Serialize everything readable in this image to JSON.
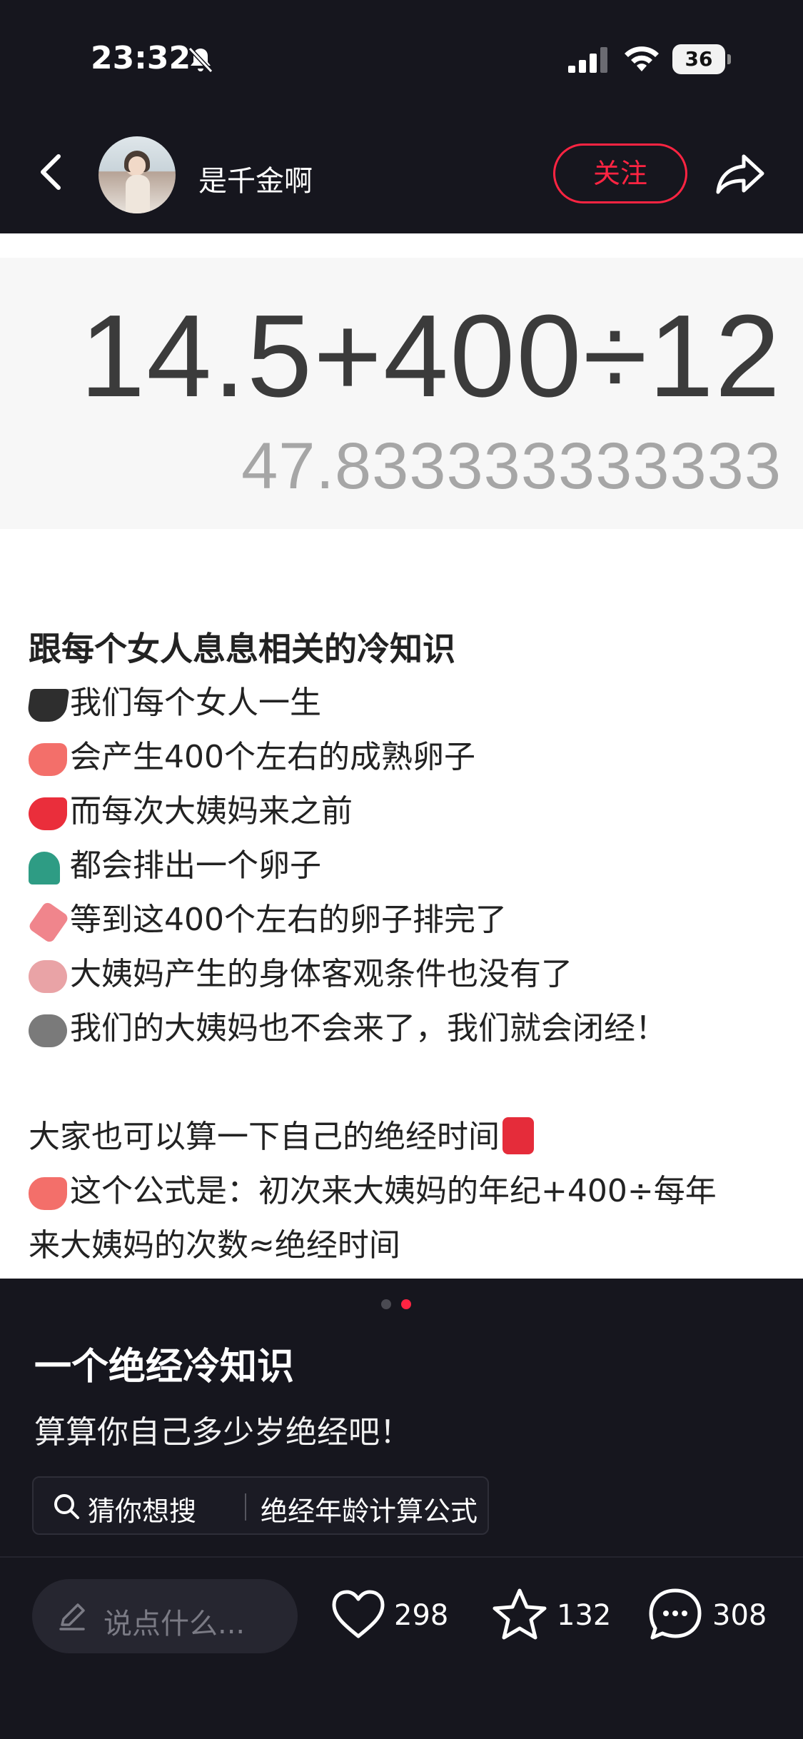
{
  "status_bar": {
    "time": "23:32",
    "battery_level": "36",
    "icons": [
      "bell-off-icon",
      "cellular-signal-icon",
      "wifi-icon",
      "battery-icon"
    ]
  },
  "header": {
    "username": "是千金啊",
    "follow_label": "关注",
    "icons": [
      "back-icon",
      "share-icon"
    ]
  },
  "post": {
    "image": {
      "expression": "14.5+400÷12",
      "result": "47.833333333333"
    },
    "title": "跟每个女人息息相关的冷知识",
    "lines": [
      {
        "emoji": "graduation-cap-emoji",
        "text": "我们每个女人一生"
      },
      {
        "emoji": "pointing-hand-emoji",
        "text": "会产生400个左右的成熟卵子"
      },
      {
        "emoji": "flexed-biceps-emoji",
        "text": "而每次大姨妈来之前"
      },
      {
        "emoji": "sprout-emoji",
        "text": "都会排出一个卵子"
      },
      {
        "emoji": "syringe-emoji",
        "text": "等到这400个左右的卵子排完了"
      },
      {
        "emoji": "blushing-face-emoji",
        "text": "大姨妈产生的身体客观条件也没有了"
      },
      {
        "emoji": "rock-face-emoji",
        "text": "我们的大姨妈也不会来了，我们就会闭经！"
      }
    ],
    "tip_line": "大家也可以算一下自己的绝经时间",
    "formula_line_1": "这个公式是：初次来大姨妈的年纪+400÷每年",
    "formula_line_2": "来大姨妈的次数≈绝经时间"
  },
  "pagination": {
    "current": 2,
    "total": 2
  },
  "note": {
    "title": "一个绝经冷知识",
    "description": "算算你自己多少岁绝经吧！",
    "search_prefix": "猜你想搜",
    "search_query": "绝经年龄计算公式"
  },
  "bottom_bar": {
    "comment_placeholder": "说点什么...",
    "likes": "298",
    "collects": "132",
    "comments": "308"
  },
  "colors": {
    "accent": "#ff2442",
    "background": "#16161e",
    "content_background": "#ffffff"
  }
}
